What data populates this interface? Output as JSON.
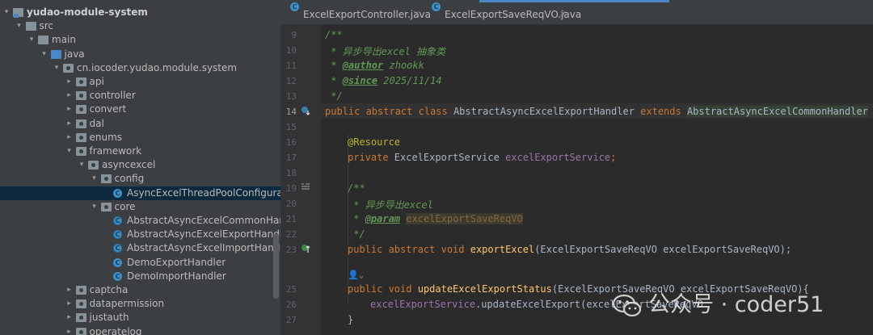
{
  "project_tree": {
    "items": [
      {
        "label": "yudao-module-system",
        "depth": 0,
        "expanded": true,
        "icon": "module-folder-icon",
        "bold": true
      },
      {
        "label": "src",
        "depth": 1,
        "expanded": true,
        "icon": "folder-icon"
      },
      {
        "label": "main",
        "depth": 2,
        "expanded": true,
        "icon": "folder-icon"
      },
      {
        "label": "java",
        "depth": 3,
        "expanded": true,
        "icon": "source-folder-icon"
      },
      {
        "label": "cn.iocoder.yudao.module.system",
        "depth": 4,
        "expanded": true,
        "icon": "package-icon"
      },
      {
        "label": "api",
        "depth": 5,
        "expanded": false,
        "icon": "package-icon"
      },
      {
        "label": "controller",
        "depth": 5,
        "expanded": false,
        "icon": "package-icon"
      },
      {
        "label": "convert",
        "depth": 5,
        "expanded": false,
        "icon": "package-icon"
      },
      {
        "label": "dal",
        "depth": 5,
        "expanded": false,
        "icon": "package-icon"
      },
      {
        "label": "enums",
        "depth": 5,
        "expanded": false,
        "icon": "package-icon"
      },
      {
        "label": "framework",
        "depth": 5,
        "expanded": true,
        "icon": "package-icon"
      },
      {
        "label": "asyncexcel",
        "depth": 6,
        "expanded": true,
        "icon": "package-icon"
      },
      {
        "label": "config",
        "depth": 7,
        "expanded": true,
        "icon": "package-icon"
      },
      {
        "label": "AsyncExcelThreadPoolConfiguration",
        "depth": 8,
        "icon": "class-icon",
        "selected": true
      },
      {
        "label": "core",
        "depth": 7,
        "expanded": true,
        "icon": "package-icon"
      },
      {
        "label": "AbstractAsyncExcelCommonHandle",
        "depth": 8,
        "icon": "abstract-class-icon"
      },
      {
        "label": "AbstractAsyncExcelExportHandler",
        "depth": 8,
        "icon": "abstract-class-icon"
      },
      {
        "label": "AbstractAsyncExcelImportHandler",
        "depth": 8,
        "icon": "abstract-class-icon"
      },
      {
        "label": "DemoExportHandler",
        "depth": 8,
        "icon": "class-icon"
      },
      {
        "label": "DemoImportHandler",
        "depth": 8,
        "icon": "class-icon"
      },
      {
        "label": "captcha",
        "depth": 5,
        "expanded": false,
        "icon": "package-icon"
      },
      {
        "label": "datapermission",
        "depth": 5,
        "expanded": false,
        "icon": "package-icon"
      },
      {
        "label": "justauth",
        "depth": 5,
        "expanded": false,
        "icon": "package-icon"
      },
      {
        "label": "operatelog",
        "depth": 5,
        "expanded": false,
        "icon": "package-icon"
      }
    ]
  },
  "editor": {
    "tabs": [
      {
        "label": "ExcelExportController.java",
        "active": false
      },
      {
        "label": "ExcelExportSaveReqVO.java",
        "active": false
      }
    ],
    "line_numbers": [
      "9",
      "10",
      "11",
      "12",
      "13",
      "14",
      "15",
      "16",
      "17",
      "18",
      "19",
      "20",
      "21",
      "22",
      "23",
      "24",
      "25",
      "26",
      "27"
    ],
    "current_line": "14",
    "inline_hint": "zhaokk",
    "code": {
      "l9": "/**",
      "l10": " * 异步导出excel 抽象类",
      "l11_tag": "@author",
      "l11_val": " zhookk",
      "l12_tag": "@since",
      "l12_val": " 2025/11/14",
      "l13": " */",
      "l14_kw": "public abstract class ",
      "l14_name": "AbstractAsyncExcelExportHandler ",
      "l14_ext": "extends ",
      "l14_super": "AbstractAsyncExcelCommonHandler",
      "l14_end": " {",
      "l16": "@Resource",
      "l17_kw": "private ",
      "l17_type": "ExcelExportService ",
      "l17_fld": "excelExportService",
      "l17_end": ";",
      "l19": "/**",
      "l20": " * 异步导出excel",
      "l21_tag": "@param",
      "l21_val": "excelExportSaveReqVO",
      "l22": " */",
      "l23_kw": "public abstract void ",
      "l23_fn": "exportExcel",
      "l23_rest": "(ExcelExportSaveReqVO excelExportSaveReqVO);",
      "l25_kw": "public void ",
      "l25_fn": "updateExcelExportStatus",
      "l25_rest": "(ExcelExportSaveReqVO excelExportSaveReqVO){",
      "l26_fld": "excelExportService",
      "l26_rest": ".updateExcelExport(excelExportSaveReqVO",
      "l27": "}"
    }
  },
  "watermark": {
    "text": "公众号 · coder51"
  },
  "colors": {
    "background": "#2b2b2b",
    "tree_bg": "#3c3f41",
    "keyword": "#cc7832",
    "comment": "#629755",
    "field": "#9876aa",
    "method": "#ffc66d",
    "annotation": "#bbb529",
    "selection": "#0d293e"
  }
}
